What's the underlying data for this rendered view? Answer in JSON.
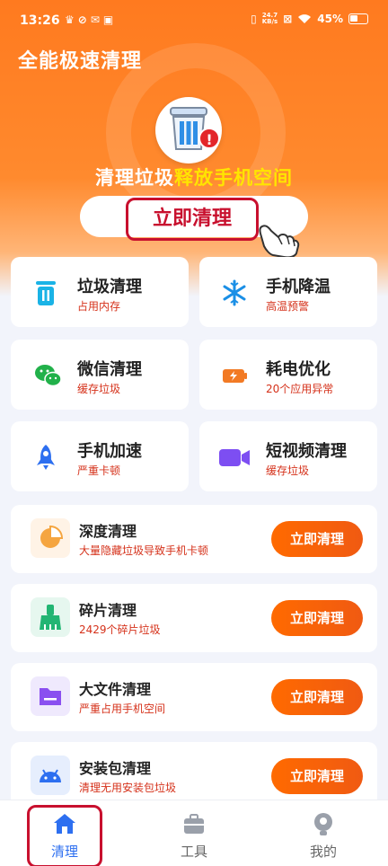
{
  "status_bar": {
    "time": "13:26",
    "net_speed_value": "24.7",
    "net_speed_unit": "KB/s",
    "battery": "45%"
  },
  "header": {
    "app_title": "全能极速清理",
    "headline_white": "清理垃圾",
    "headline_yellow": "释放手机空间",
    "main_button": "立即清理"
  },
  "feature_cards": [
    {
      "title": "垃圾清理",
      "subtitle": "占用内存",
      "icon": "trash-icon"
    },
    {
      "title": "手机降温",
      "subtitle": "高温预警",
      "icon": "snowflake-icon"
    },
    {
      "title": "微信清理",
      "subtitle": "缓存垃圾",
      "icon": "wechat-icon"
    },
    {
      "title": "耗电优化",
      "subtitle": "20个应用异常",
      "icon": "battery-charging-icon"
    },
    {
      "title": "手机加速",
      "subtitle": "严重卡顿",
      "icon": "rocket-icon"
    },
    {
      "title": "短视频清理",
      "subtitle": "缓存垃圾",
      "icon": "video-camera-icon"
    }
  ],
  "list_rows": [
    {
      "title": "深度清理",
      "subtitle": "大量隐藏垃圾导致手机卡顿",
      "button": "立即清理",
      "icon": "pie-chart-icon"
    },
    {
      "title": "碎片清理",
      "subtitle": "2429个碎片垃圾",
      "button": "立即清理",
      "icon": "broom-icon"
    },
    {
      "title": "大文件清理",
      "subtitle": "严重占用手机空间",
      "button": "立即清理",
      "icon": "folder-icon"
    },
    {
      "title": "安装包清理",
      "subtitle": "清理无用安装包垃圾",
      "button": "立即清理",
      "icon": "android-icon"
    }
  ],
  "bottom_nav": [
    {
      "label": "清理",
      "icon": "home-icon",
      "active": true
    },
    {
      "label": "工具",
      "icon": "toolbox-icon",
      "active": false
    },
    {
      "label": "我的",
      "icon": "profile-icon",
      "active": false
    }
  ],
  "colors": {
    "brand_orange": "#ff7a1f",
    "alert_red": "#d5311a",
    "nav_active": "#2d6ff0",
    "nav_inactive": "#8a8f99"
  }
}
